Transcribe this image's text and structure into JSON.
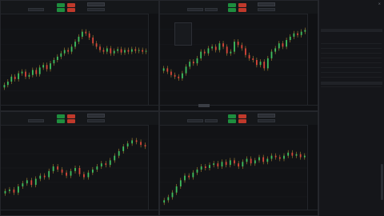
{
  "colors": {
    "bull": "#3fbf5e",
    "bear": "#d9463a",
    "wick": "#c9a23a",
    "grid": "#1c1e22"
  },
  "panes": [
    {
      "series": [
        20,
        24,
        30,
        27,
        34,
        36,
        30,
        32,
        38,
        33,
        41,
        44,
        39,
        46,
        50,
        54,
        58,
        62,
        60,
        66,
        72,
        78,
        84,
        82,
        77,
        70,
        66,
        62,
        60,
        64,
        58,
        61,
        63,
        59,
        62,
        60,
        63,
        61,
        62,
        60,
        61
      ]
    },
    {
      "series": [
        40,
        36,
        32,
        30,
        28,
        34,
        42,
        48,
        46,
        52,
        60,
        58,
        64,
        66,
        62,
        70,
        66,
        58,
        60,
        72,
        68,
        64,
        56,
        52,
        50,
        44,
        48,
        40,
        52,
        60,
        64,
        70,
        66,
        74,
        78,
        82,
        80,
        84,
        86
      ]
    },
    {
      "series": [
        20,
        22,
        18,
        26,
        30,
        34,
        28,
        36,
        40,
        38,
        46,
        52,
        48,
        44,
        40,
        46,
        50,
        42,
        38,
        44,
        48,
        52,
        56,
        54,
        60,
        66,
        72,
        78,
        82,
        86,
        84,
        80,
        78
      ]
    },
    {
      "series": [
        8,
        12,
        18,
        26,
        34,
        40,
        38,
        44,
        48,
        52,
        50,
        54,
        56,
        52,
        58,
        54,
        60,
        56,
        52,
        58,
        62,
        56,
        60,
        64,
        58,
        62,
        66,
        64,
        62,
        66,
        70,
        66,
        68,
        64,
        66
      ]
    }
  ],
  "side": {
    "markets": [
      {
        "c": [
          "",
          "",
          "",
          ""
        ]
      },
      {
        "c": [
          "",
          "",
          "",
          ""
        ]
      },
      {
        "c": [
          "",
          "",
          "",
          ""
        ]
      },
      {
        "c": [
          "",
          "",
          "",
          ""
        ]
      },
      {
        "c": [
          "",
          "",
          "",
          ""
        ]
      },
      {
        "c": [
          "",
          "",
          "",
          ""
        ]
      },
      {
        "c": [
          "",
          "",
          "",
          ""
        ]
      },
      {
        "c": [
          "",
          "",
          "",
          ""
        ]
      },
      {
        "c": [
          "",
          "",
          "",
          ""
        ]
      },
      {
        "c": [
          "",
          "",
          "",
          ""
        ]
      }
    ],
    "tree": [
      {
        "label": "",
        "value": "",
        "group": true
      },
      {
        "label": "",
        "value": ""
      },
      {
        "label": "",
        "value": ""
      },
      {
        "label": "",
        "value": ""
      },
      {
        "label": "",
        "value": ""
      },
      {
        "label": "",
        "value": ""
      },
      {
        "label": "",
        "value": "",
        "group": true
      },
      {
        "label": "",
        "value": ""
      },
      {
        "label": "",
        "value": ""
      },
      {
        "label": "",
        "value": ""
      },
      {
        "label": "",
        "value": ""
      },
      {
        "label": "",
        "value": ""
      },
      {
        "label": "",
        "value": "",
        "group": true
      },
      {
        "label": "",
        "value": ""
      },
      {
        "label": "",
        "value": ""
      },
      {
        "label": "",
        "value": ""
      },
      {
        "label": "",
        "value": ""
      },
      {
        "label": "",
        "value": "",
        "group": true
      },
      {
        "label": "",
        "value": ""
      },
      {
        "label": "",
        "value": ""
      },
      {
        "label": "",
        "value": ""
      },
      {
        "label": "",
        "value": ""
      },
      {
        "label": "",
        "value": ""
      },
      {
        "label": "",
        "value": ""
      },
      {
        "label": "",
        "value": ""
      },
      {
        "label": "",
        "value": ""
      },
      {
        "label": "",
        "value": ""
      },
      {
        "label": "",
        "value": ""
      },
      {
        "label": "",
        "value": ""
      },
      {
        "label": "",
        "value": ""
      },
      {
        "label": "",
        "value": ""
      },
      {
        "label": "",
        "value": ""
      },
      {
        "label": "",
        "value": ""
      },
      {
        "label": "",
        "value": ""
      }
    ]
  }
}
